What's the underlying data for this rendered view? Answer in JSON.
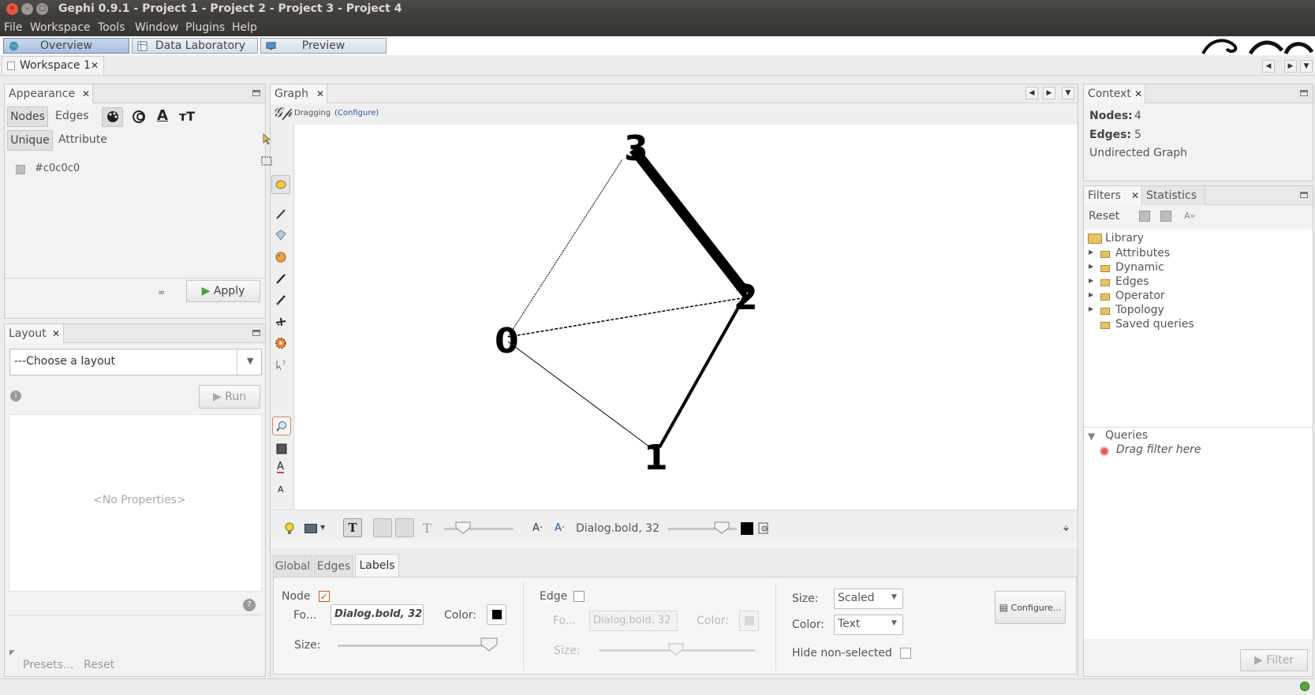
{
  "window": {
    "title": "Gephi 0.9.1 - Project 1 - Project 2 - Project 3 - Project 4"
  },
  "menu": [
    "File",
    "Workspace",
    "Tools",
    "Window",
    "Plugins",
    "Help"
  ],
  "perspectives": [
    "Overview",
    "Data Laboratory",
    "Preview"
  ],
  "workspace_tab": "Workspace 1",
  "appearance": {
    "tab": "Appearance",
    "subtabs": [
      "Nodes",
      "Edges"
    ],
    "modes": [
      "Unique",
      "Attribute"
    ],
    "color_value": "#c0c0c0",
    "apply_label": "Apply"
  },
  "layout": {
    "tab": "Layout",
    "select_value": "---Choose a layout",
    "run_label": "Run",
    "no_props": "<No Properties>",
    "presets_label": "Presets...",
    "reset_label": "Reset"
  },
  "graph": {
    "tab": "Graph",
    "mode_label": "Dragging",
    "configure_link": "(Configure)",
    "font_label": "Dialog.bold, 32",
    "nodes": [
      {
        "label": "0"
      },
      {
        "label": "1"
      },
      {
        "label": "2"
      },
      {
        "label": "3"
      }
    ]
  },
  "properties": {
    "tabs": [
      "Global",
      "Edges",
      "Labels"
    ],
    "node_label": "Node",
    "node_checked": true,
    "font_short": "Fo...",
    "node_font": "Dialog.bold, 32",
    "color_label": "Color:",
    "size_label": "Size:",
    "edge_label": "Edge",
    "edge_font": "Dialog.bold, 32",
    "size_mode_label": "Size:",
    "size_mode_value": "Scaled",
    "color_mode_label": "Color:",
    "color_mode_value": "Text",
    "hide_non_selected": "Hide non-selected",
    "configure_btn": "Configure..."
  },
  "context": {
    "tab": "Context",
    "nodes_label": "Nodes:",
    "nodes_value": "4",
    "edges_label": "Edges:",
    "edges_value": "5",
    "graph_type": "Undirected Graph"
  },
  "filters": {
    "tabs": [
      "Filters",
      "Statistics"
    ],
    "reset_label": "Reset",
    "library": "Library",
    "items": [
      "Attributes",
      "Dynamic",
      "Edges",
      "Operator",
      "Topology",
      "Saved queries"
    ],
    "queries": "Queries",
    "drag_hint": "Drag filter here",
    "filter_btn": "Filter"
  }
}
